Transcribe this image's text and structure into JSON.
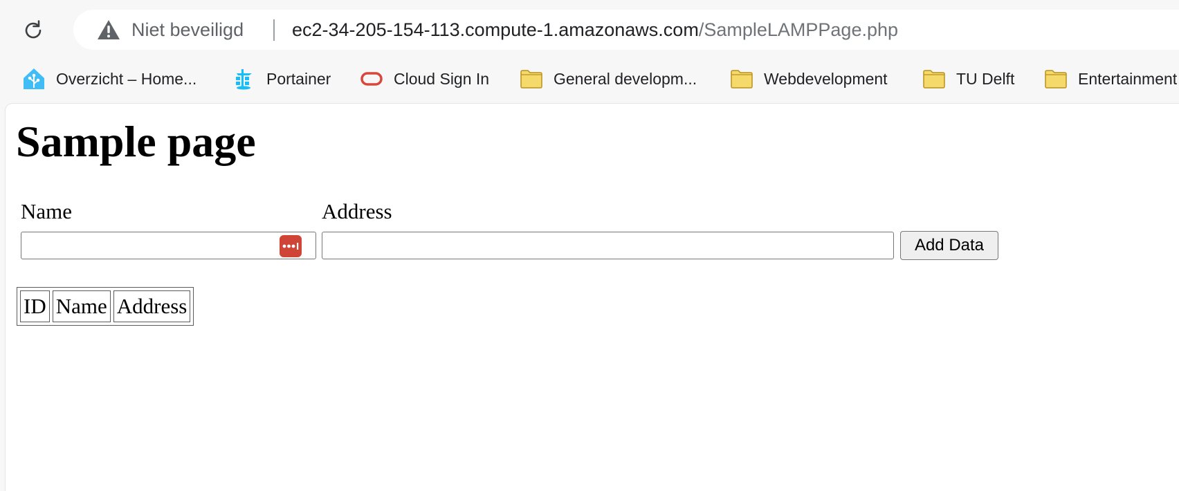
{
  "browser": {
    "security_label": "Niet beveiligd",
    "url_host": "ec2-34-205-154-113.compute-1.amazonaws.com",
    "url_path": "/SampleLAMPPage.php"
  },
  "bookmarks": [
    {
      "label": "Overzicht – Home...",
      "icon": "home-assistant-icon"
    },
    {
      "label": "Portainer",
      "icon": "portainer-icon"
    },
    {
      "label": "Cloud Sign In",
      "icon": "oracle-cloud-icon"
    },
    {
      "label": "General developm...",
      "icon": "folder-icon"
    },
    {
      "label": "Webdevelopment",
      "icon": "folder-icon"
    },
    {
      "label": "TU Delft",
      "icon": "folder-icon"
    },
    {
      "label": "Entertainment",
      "icon": "folder-icon"
    }
  ],
  "page": {
    "title": "Sample page",
    "form": {
      "name_label": "Name",
      "name_value": "",
      "address_label": "Address",
      "address_value": "",
      "submit_label": "Add Data"
    },
    "table": {
      "headers": [
        "ID",
        "Name",
        "Address"
      ],
      "rows": []
    }
  },
  "colors": {
    "password_manager_accent": "#d04437",
    "folder": "#f6d96b",
    "home_assistant": "#41bdf5"
  }
}
